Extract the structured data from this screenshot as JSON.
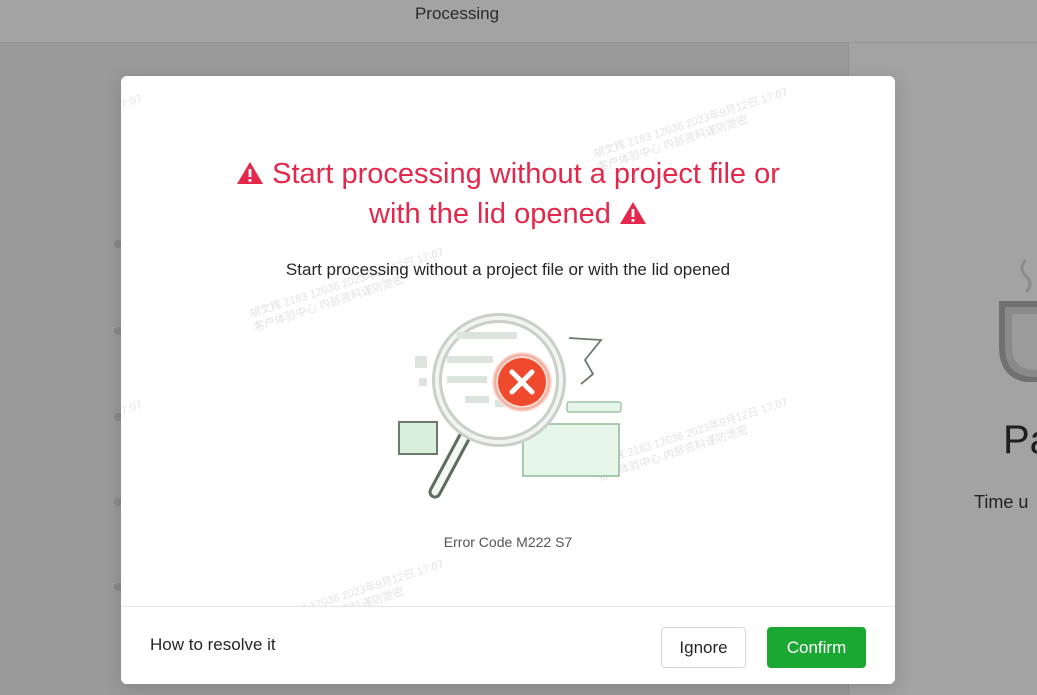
{
  "app": {
    "title": "Processing",
    "right_panel": {
      "heading_partial": "Pa",
      "subtext_partial": "Time u"
    }
  },
  "modal": {
    "title_line1": "Start processing without a project file or",
    "title_line2": "with the lid opened",
    "title_icon": "warning-triangle-icon",
    "description": "Start processing without a project file or with the lid opened",
    "illustration_icon": "magnifier-error-icon",
    "error_code": "Error Code M222 S7",
    "footer": {
      "resolve_link": "How to resolve it",
      "ignore_label": "Ignore",
      "confirm_label": "Confirm"
    }
  },
  "watermark": {
    "line1": "胡文辉 2183 12036 2023年9月12日 17:07",
    "line2": "客户体验中心 内部资料谨防泄密",
    "time": "17:07"
  },
  "colors": {
    "title_red": "#e3284b",
    "confirm_green": "#1aa832",
    "error_red": "#f04a2e",
    "overlay_gray": "#9e9e9e"
  }
}
